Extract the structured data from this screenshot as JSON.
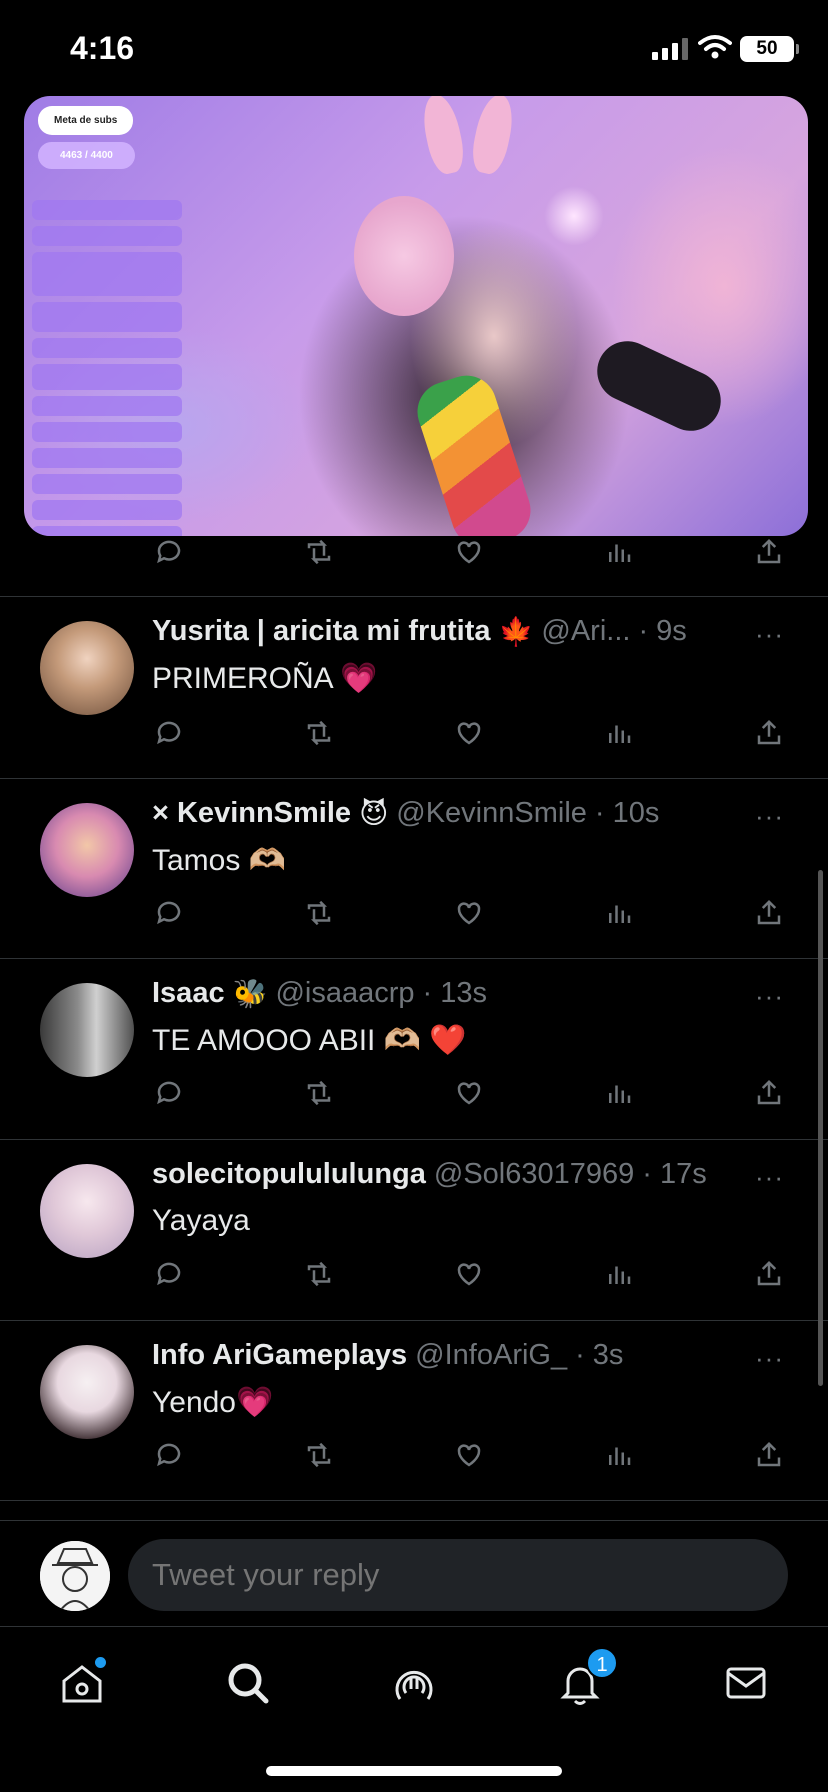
{
  "status_bar": {
    "time": "4:16",
    "battery": "50"
  },
  "video": {
    "overlay_title": "Meta de subs",
    "overlay_count": "4463 / 4400"
  },
  "tweets": [
    {
      "name": "Yusrita | aricita mi frutita",
      "name_emoji": "🍁",
      "handle": "@Ari...",
      "time": "9s",
      "text": "PRIMEROÑA 💗"
    },
    {
      "name": "× KevinnSmile",
      "name_emoji": "😈",
      "handle": "@KevinnSmile",
      "time": "10s",
      "text": "Tamos 🫶🏼"
    },
    {
      "name": "Isaac",
      "name_emoji": "🐝",
      "handle": "@isaaacrp",
      "time": "13s",
      "text": "TE AMOOO ABII 🫶🏼 ❤️"
    },
    {
      "name": "solecitopulululunga",
      "name_emoji": "",
      "handle": "@Sol63017969",
      "time": "17s",
      "text": "Yayaya"
    },
    {
      "name": "Info AriGameplays",
      "name_emoji": "",
      "handle": "@InfoAriG_",
      "time": "3s",
      "text": "Yendo💗"
    }
  ],
  "separator_dot": "·",
  "more_glyph": "···",
  "reply": {
    "placeholder": "Tweet your reply"
  },
  "nav": {
    "notifications_badge": "1"
  },
  "icons": [
    "reply-icon",
    "retweet-icon",
    "like-icon",
    "views-icon",
    "share-icon",
    "home-icon",
    "search-icon",
    "spaces-icon",
    "notifications-icon",
    "messages-icon"
  ]
}
